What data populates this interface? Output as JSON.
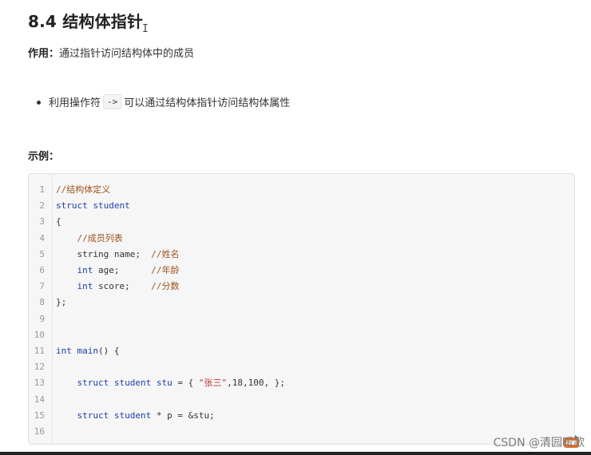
{
  "title": "8.4 结构体指针",
  "purpose": {
    "label": "作用：",
    "text": "通过指针访问结构体中的成员"
  },
  "bullet": {
    "before": "利用操作符",
    "code": "->",
    "after": "可以通过结构体指针访问结构体属性"
  },
  "example_label": "示例：",
  "code_lines": [
    {
      "n": "1",
      "parts": [
        {
          "t": "//结构体定义",
          "c": "cm"
        }
      ]
    },
    {
      "n": "2",
      "parts": [
        {
          "t": "struct student",
          "c": "kw"
        }
      ]
    },
    {
      "n": "3",
      "parts": [
        {
          "t": "{",
          "c": ""
        }
      ]
    },
    {
      "n": "4",
      "parts": [
        {
          "t": "    ",
          "c": ""
        },
        {
          "t": "//成员列表",
          "c": "cm"
        }
      ]
    },
    {
      "n": "5",
      "parts": [
        {
          "t": "    string name;  ",
          "c": ""
        },
        {
          "t": "//姓名",
          "c": "cm"
        }
      ]
    },
    {
      "n": "6",
      "parts": [
        {
          "t": "    ",
          "c": ""
        },
        {
          "t": "int",
          "c": "kw"
        },
        {
          "t": " age;      ",
          "c": ""
        },
        {
          "t": "//年龄",
          "c": "cm"
        }
      ]
    },
    {
      "n": "7",
      "parts": [
        {
          "t": "    ",
          "c": ""
        },
        {
          "t": "int",
          "c": "kw"
        },
        {
          "t": " score;    ",
          "c": ""
        },
        {
          "t": "//分数",
          "c": "cm"
        }
      ]
    },
    {
      "n": "8",
      "parts": [
        {
          "t": "};",
          "c": ""
        }
      ]
    },
    {
      "n": "9",
      "parts": []
    },
    {
      "n": "10",
      "parts": []
    },
    {
      "n": "11",
      "parts": [
        {
          "t": "int",
          "c": "kw"
        },
        {
          "t": " ",
          "c": ""
        },
        {
          "t": "main",
          "c": "kw"
        },
        {
          "t": "() {",
          "c": ""
        }
      ]
    },
    {
      "n": "12",
      "parts": []
    },
    {
      "n": "13",
      "parts": [
        {
          "t": "    ",
          "c": ""
        },
        {
          "t": "struct student",
          "c": "kw"
        },
        {
          "t": " ",
          "c": ""
        },
        {
          "t": "stu",
          "c": "kw"
        },
        {
          "t": " = { ",
          "c": ""
        },
        {
          "t": "\"张三\"",
          "c": "st"
        },
        {
          "t": ",18,100, };",
          "c": ""
        }
      ]
    },
    {
      "n": "14",
      "parts": []
    },
    {
      "n": "15",
      "parts": [
        {
          "t": "    ",
          "c": ""
        },
        {
          "t": "struct student",
          "c": "kw"
        },
        {
          "t": " * p = &stu;",
          "c": ""
        }
      ]
    },
    {
      "n": "16",
      "parts": []
    }
  ],
  "watermark": "CSDN @清园暖歌",
  "icons": {
    "cursor": "text-cursor-icon",
    "bullet": "bullet-icon",
    "ime": "sogou-ime-icon"
  },
  "colors": {
    "keyword": "#1a3ea8",
    "comment": "#a0521c",
    "string": "#b7342c",
    "ime_orange": "#f26a1b"
  }
}
